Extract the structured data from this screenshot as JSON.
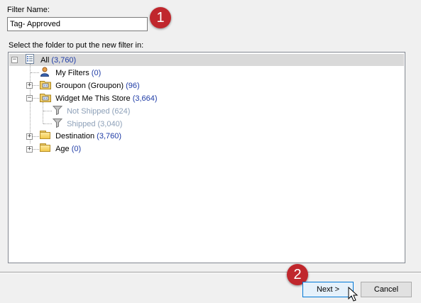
{
  "filter_name": {
    "label": "Filter Name:",
    "value": "Tag- Approved"
  },
  "folder_prompt": "Select the folder to put the new filter in:",
  "tree": {
    "all": {
      "label": "All",
      "count": "(3,760)",
      "expander": "−"
    },
    "my_filters": {
      "label": "My Filters",
      "count": "(0)"
    },
    "groupon": {
      "label": "Groupon (Groupon)",
      "count": "(96)",
      "expander": "+"
    },
    "widget_store": {
      "label": "Widget Me This Store",
      "count": "(3,664)",
      "expander": "−"
    },
    "not_shipped": {
      "label": "Not Shipped",
      "count": "(624)"
    },
    "shipped": {
      "label": "Shipped",
      "count": "(3,040)"
    },
    "destination": {
      "label": "Destination",
      "count": "(3,760)",
      "expander": "+"
    },
    "age": {
      "label": "Age",
      "count": "(0)",
      "expander": "+"
    }
  },
  "buttons": {
    "next": "Next >",
    "cancel": "Cancel"
  },
  "callouts": {
    "one": "1",
    "two": "2"
  },
  "colors": {
    "callout": "#c0272d",
    "count_text": "#1f3ca6",
    "selected_row": "#d9d9d9",
    "default_button_border": "#0078d7"
  }
}
